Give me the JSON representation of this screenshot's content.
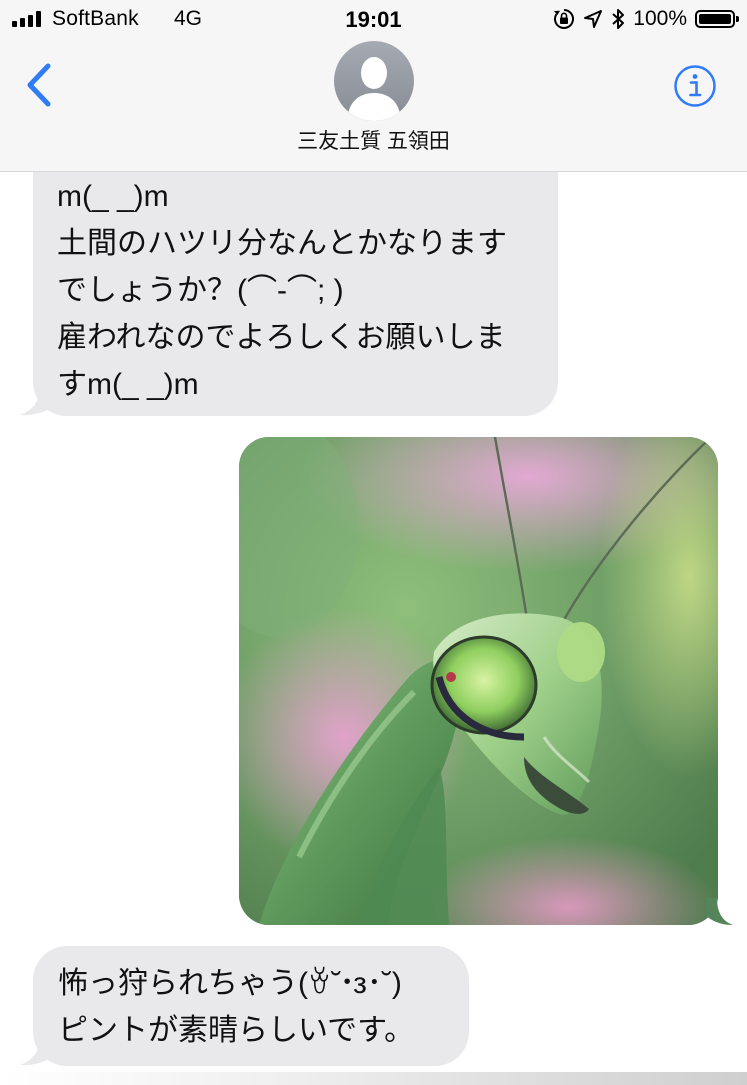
{
  "status_bar": {
    "carrier": "SoftBank",
    "network": "4G",
    "time": "19:01",
    "battery_percent": "100%",
    "battery_level": 1.0,
    "signal_bars": 4,
    "icons": [
      "orientation-lock-icon",
      "location-arrow-icon",
      "bluetooth-icon",
      "battery-icon"
    ]
  },
  "nav": {
    "contact_name": "三友土質 五領田",
    "back_icon": "chevron-left-icon",
    "info_icon": "info-icon",
    "avatar_icon": "person-silhouette-icon"
  },
  "messages": [
    {
      "direction": "incoming",
      "type": "text",
      "lines": [
        "m(_ _)m",
        "土間のハツリ分なんとかなります",
        "でしょうか？(⌒-⌒; )",
        "雇われなのでよろしくお願いしま",
        "すm(_ _)m"
      ]
    },
    {
      "direction": "outgoing",
      "type": "photo",
      "subject": "praying-mantis-photo"
    },
    {
      "direction": "incoming",
      "type": "text",
      "lines": [
        "怖っ狩られちゃう(ꈊ˘･з･˘)",
        "ピントが素晴らしいです。"
      ]
    }
  ],
  "colors": {
    "accent": "#2f7cf6",
    "incoming_bubble": "#e9e9eb",
    "header_background": "#f6f6f7"
  }
}
